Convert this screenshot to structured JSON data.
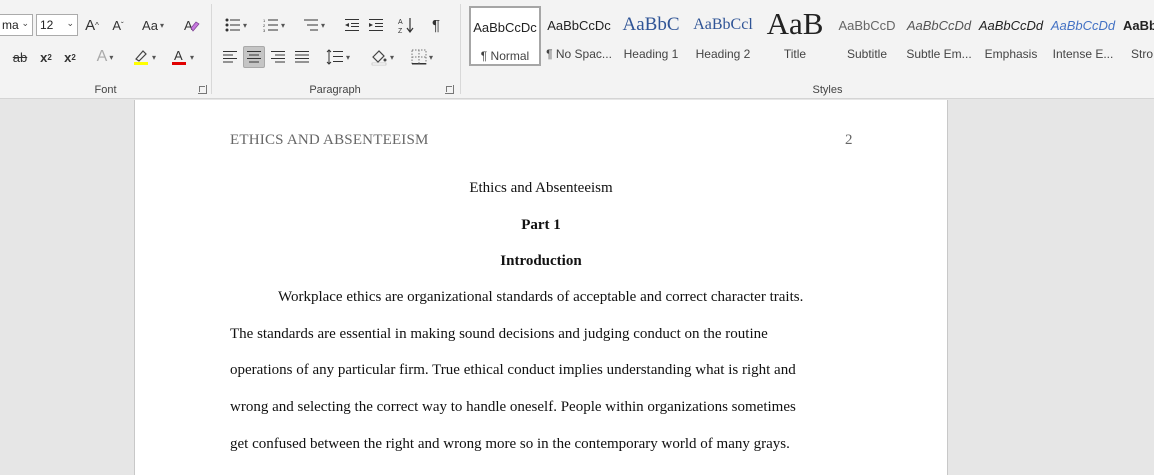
{
  "ribbon": {
    "font": {
      "name": "ma",
      "size": "12",
      "label": "Font"
    },
    "paragraph": {
      "label": "Paragraph"
    },
    "styles": {
      "label": "Styles",
      "items": [
        {
          "sample": "AaBbCcDc",
          "name": "¶ Normal"
        },
        {
          "sample": "AaBbCcDc",
          "name": "¶ No Spac..."
        },
        {
          "sample": "AaBbC",
          "name": "Heading 1"
        },
        {
          "sample": "AaBbCcl",
          "name": "Heading 2"
        },
        {
          "sample": "AaB",
          "name": "Title"
        },
        {
          "sample": "AaBbCcD",
          "name": "Subtitle"
        },
        {
          "sample": "AaBbCcDd",
          "name": "Subtle Em..."
        },
        {
          "sample": "AaBbCcDd",
          "name": "Emphasis"
        },
        {
          "sample": "AaBbCcDd",
          "name": "Intense E..."
        },
        {
          "sample": "AaBb",
          "name": "Stro"
        }
      ]
    },
    "colors": {
      "highlight": "#ffff00",
      "font_color": "#e00000",
      "heading_blue": "#2f5496"
    }
  },
  "document": {
    "header_text": "ETHICS AND ABSENTEEISM",
    "page_number": "2",
    "title": "Ethics and Absenteeism",
    "part": "Part 1",
    "section": "Introduction",
    "lines": [
      "Workplace ethics are organizational standards of acceptable and correct character traits.",
      "The standards are essential in making sound decisions and judging conduct on the routine",
      "operations of any particular firm. True ethical conduct implies understanding what is right and",
      "wrong and selecting the correct way to handle oneself. People within organizations sometimes",
      "get confused between the right and wrong more so in the contemporary world of many grays."
    ]
  }
}
